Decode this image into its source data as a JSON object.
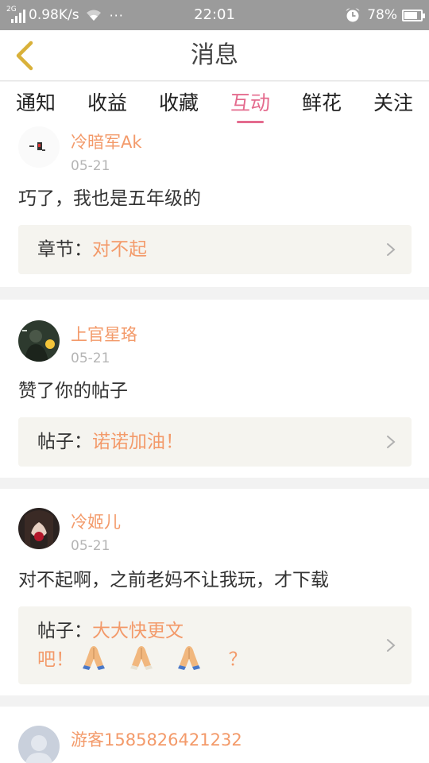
{
  "statusbar": {
    "network_tag": "2G",
    "speed": "0.98K/s",
    "dots": "···",
    "time": "22:01",
    "battery": "78%"
  },
  "header": {
    "title": "消息"
  },
  "tabs": [
    {
      "label": "通知",
      "active": false
    },
    {
      "label": "收益",
      "active": false
    },
    {
      "label": "收藏",
      "active": false
    },
    {
      "label": "互动",
      "active": true
    },
    {
      "label": "鲜花",
      "active": false
    },
    {
      "label": "关注",
      "active": false
    }
  ],
  "messages": [
    {
      "user": "冷暗军Ak",
      "date": "05-21",
      "text": "巧了，我也是五年级的",
      "ref_label": "章节：",
      "ref_value": "对不起"
    },
    {
      "user": "上官星珞",
      "date": "05-21",
      "text": "赞了你的帖子",
      "ref_label": "帖子：",
      "ref_value": "诺诺加油！"
    },
    {
      "user": "冷姬儿",
      "date": "05-21",
      "text": "对不起啊，之前老妈不让我玩，才下载",
      "ref_label": "帖子：",
      "ref_value": "大大快更文",
      "ref_value_2": "吧！",
      "ref_value_tail": "？"
    },
    {
      "user": "游客1585826421232"
    }
  ],
  "colors": {
    "accent_pink": "#e46b8e",
    "name_orange": "#f39a6a",
    "back_arrow": "#d9b13a"
  }
}
